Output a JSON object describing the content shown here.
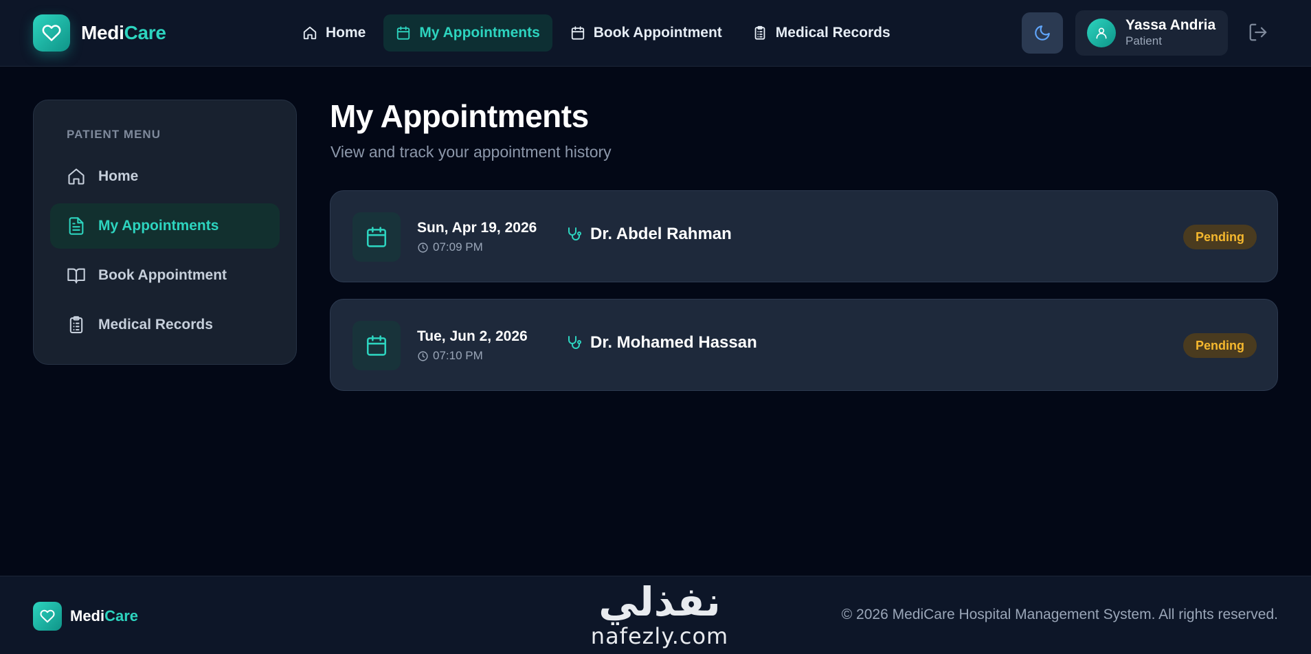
{
  "brand": {
    "name_part1": "Medi",
    "name_part2": "Care"
  },
  "topnav": {
    "items": [
      {
        "label": "Home",
        "icon": "home-icon",
        "active": false
      },
      {
        "label": "My Appointments",
        "icon": "calendar-icon",
        "active": true
      },
      {
        "label": "Book Appointment",
        "icon": "calendar-icon",
        "active": false
      },
      {
        "label": "Medical Records",
        "icon": "clipboard-icon",
        "active": false
      }
    ]
  },
  "header": {
    "theme_icon": "moon-icon",
    "user": {
      "name": "Yassa Andria",
      "role": "Patient"
    },
    "logout_icon": "logout-icon"
  },
  "sidebar": {
    "title": "PATIENT MENU",
    "items": [
      {
        "label": "Home",
        "icon": "home-icon",
        "active": false
      },
      {
        "label": "My Appointments",
        "icon": "document-icon",
        "active": true
      },
      {
        "label": "Book Appointment",
        "icon": "book-icon",
        "active": false
      },
      {
        "label": "Medical Records",
        "icon": "clipboard-icon",
        "active": false
      }
    ]
  },
  "main": {
    "title": "My Appointments",
    "subtitle": "View and track your appointment history",
    "appointments": [
      {
        "date": "Sun, Apr 19, 2026",
        "time": "07:09 PM",
        "doctor": "Dr. Abdel Rahman",
        "status": "Pending"
      },
      {
        "date": "Tue, Jun 2, 2026",
        "time": "07:10 PM",
        "doctor": "Dr. Mohamed Hassan",
        "status": "Pending"
      }
    ]
  },
  "footer": {
    "brand_part1": "Medi",
    "brand_part2": "Care",
    "watermark_arabic": "نفذلي",
    "watermark_latin": "nafezly.com",
    "copyright": "© 2026 MediCare Hospital Management System. All rights reserved."
  },
  "colors": {
    "background": "#030816",
    "surface": "#1e293b",
    "accent": "#2dd4bf",
    "pending": "#f5b82e"
  }
}
